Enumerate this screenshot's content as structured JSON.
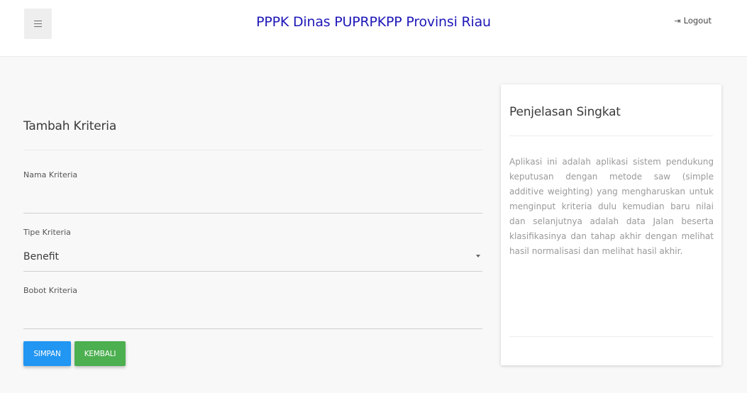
{
  "header": {
    "menu_icon": "hamburger-icon",
    "title": "PPPK Dinas PUPRPKPP Provinsi Riau",
    "logout_label": "Logout",
    "logout_icon": "sign-out-icon"
  },
  "form": {
    "title": "Tambah Kriteria",
    "fields": {
      "nama": {
        "label": "Nama Kriteria",
        "value": ""
      },
      "tipe": {
        "label": "Tipe Kriteria",
        "value": "Benefit"
      },
      "bobot": {
        "label": "Bobot Kriteria",
        "value": ""
      }
    },
    "save_label": "SIMPAN",
    "back_label": "KEMBALI"
  },
  "info_card": {
    "title": "Penjelasan Singkat",
    "text": "Aplikasi ini adalah aplikasi sistem pendukung keputusan dengan metode saw (simple additive weighting) yang mengharuskan untuk menginput kriteria dulu kemudian baru nilai dan selanjutnya adalah data Jalan beserta klasifikasinya dan tahap akhir dengan melihat hasil normalisasi dan melihat hasil akhir."
  },
  "colors": {
    "title": "#1d17b8",
    "save_button": "#2196f3",
    "back_button": "#4caf50"
  }
}
